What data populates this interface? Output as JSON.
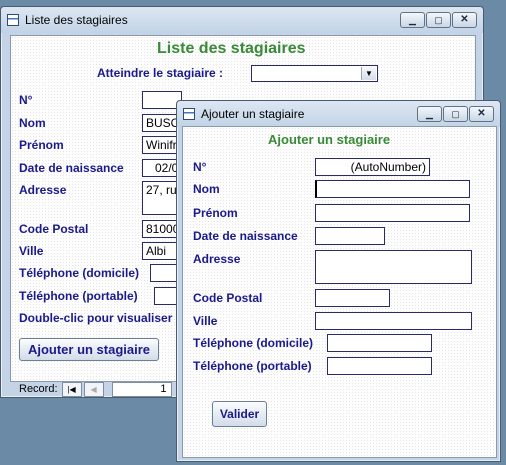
{
  "back_window": {
    "title": "Liste des stagiaires",
    "heading": "Liste des stagiaires",
    "goto_label": "Atteindre le stagiaire :",
    "goto_value": "",
    "fields": {
      "num_label": "N°",
      "nom_label": "Nom",
      "nom_value": "BUSOL",
      "prenom_label": "Prénom",
      "prenom_value": "Winifri",
      "naissance_label": "Date de naissance",
      "naissance_value": "02/0",
      "adresse_label": "Adresse",
      "adresse_value": "27, ru",
      "cp_label": "Code Postal",
      "cp_value": "81000",
      "ville_label": "Ville",
      "ville_value": "Albi",
      "tel_dom_label": "Téléphone (domicile)",
      "tel_port_label": "Téléphone (portable)",
      "dblclick_label": "Double-clic pour visualiser"
    },
    "add_button": "Ajouter un stagiaire",
    "nav": {
      "record_label": "Record:",
      "first_icon": "first-record-icon",
      "prev_icon": "prev-record-icon",
      "current": "1"
    },
    "controls": {
      "minimize": "minimize-icon",
      "maximize": "maximize-icon",
      "close": "close-icon"
    }
  },
  "front_window": {
    "title": "Ajouter un stagiaire",
    "heading": "Ajouter un stagiaire",
    "fields": {
      "num_label": "N°",
      "num_value": "(AutoNumber)",
      "nom_label": "Nom",
      "prenom_label": "Prénom",
      "naissance_label": "Date de naissance",
      "adresse_label": "Adresse",
      "cp_label": "Code Postal",
      "ville_label": "Ville",
      "tel_dom_label": "Téléphone (domicile)",
      "tel_port_label": "Téléphone (portable)"
    },
    "validate_button": "Valider",
    "controls": {
      "minimize": "minimize-icon",
      "maximize": "maximize-icon",
      "close": "close-icon"
    }
  },
  "colors": {
    "heading": "#3a8a3a",
    "label": "#1a1a8a",
    "desktop": "#6a8aa6",
    "window_frame": "#c4d4e6"
  }
}
